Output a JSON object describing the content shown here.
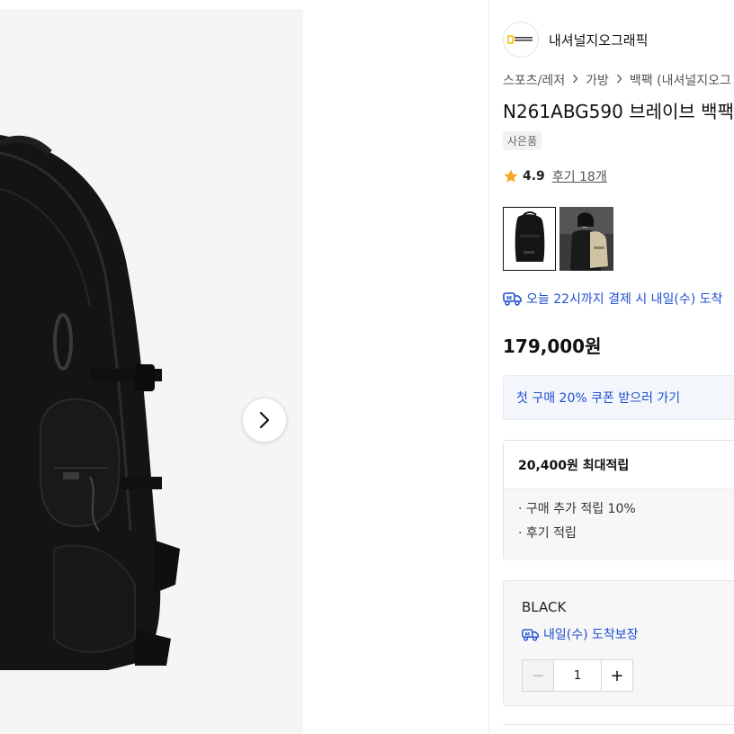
{
  "gallery": {
    "next_icon": "chevron-right-icon"
  },
  "brand": {
    "logo_icon": "brand-logo-icon",
    "name": "내셔널지오그래픽"
  },
  "breadcrumbs": [
    "스포츠/레저",
    "가방",
    "백팩 (내셔널지오그"
  ],
  "product": {
    "title": "N261ABG590 브레이브 백팩",
    "tag": "사은품",
    "rating": "4.9",
    "reviews": "후기 18개",
    "price": "179,000원"
  },
  "thumbnails": [
    {
      "name": "thumbnail-black-backpack",
      "selected": true
    },
    {
      "name": "thumbnail-model-backpack",
      "selected": false
    }
  ],
  "delivery": {
    "icon": "delivery-truck-icon",
    "text": "오늘 22시까지 결제 시 내일(수) 도착"
  },
  "coupon": {
    "text": "첫 구매 20% 쿠폰 받으러 가기"
  },
  "points": {
    "title": "20,400원 최대적립",
    "items": [
      "· 구매 추가 적립 10%",
      "· 후기 적립"
    ]
  },
  "option": {
    "color": "BLACK",
    "guarantee": "내일(수) 도착보장",
    "quantity": "1",
    "minus_label": "−",
    "plus_label": "+"
  },
  "colors": {
    "accent_blue": "#1f4fd1",
    "star": "#f5a623"
  }
}
